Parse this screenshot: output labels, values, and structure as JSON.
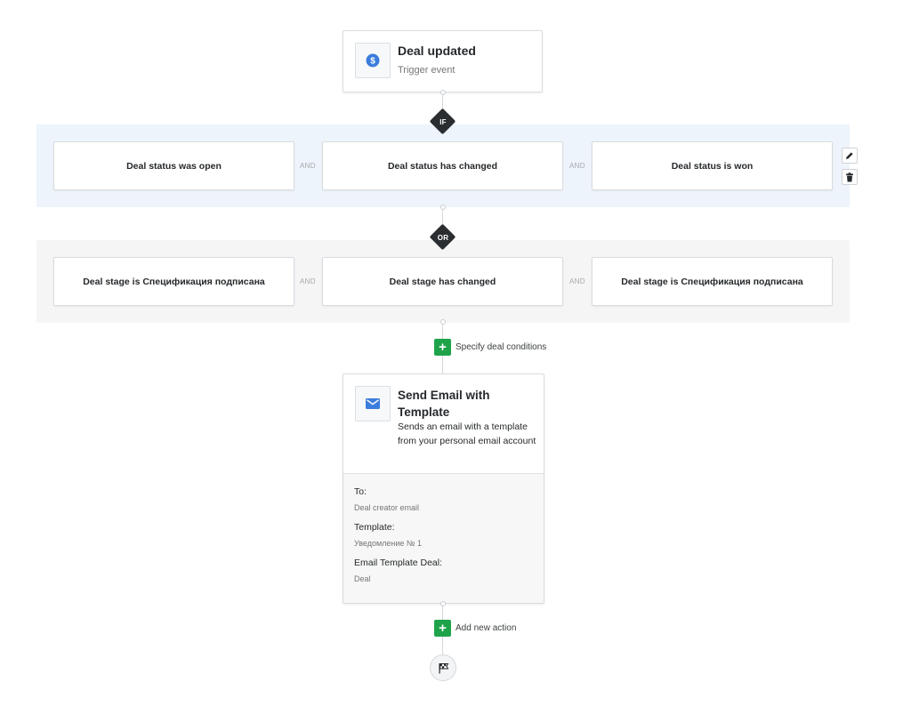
{
  "trigger": {
    "title": "Deal updated",
    "subtitle": "Trigger event",
    "icon": "dollar-icon",
    "icon_color": "#3b7ddd"
  },
  "if_group": {
    "badge": "IF",
    "conditions": [
      "Deal status was open",
      "Deal status has changed",
      "Deal status is won"
    ],
    "connector": "AND",
    "background": "#eef4fb"
  },
  "or_group": {
    "badge": "OR",
    "conditions": [
      "Deal stage is Спецификация подписана",
      "Deal stage has changed",
      "Deal stage is Спецификация подписана"
    ],
    "connector": "AND",
    "background": "#f5f5f6"
  },
  "specify_conditions": {
    "label": "Specify deal conditions",
    "icon": "plus-icon"
  },
  "action": {
    "title": "Send Email with Template",
    "description": "Sends an email with a template from your personal email account",
    "icon": "envelope-icon",
    "fields": [
      {
        "label": "To:",
        "value": "Deal creator email"
      },
      {
        "label": "Template:",
        "value": "Уведомление № 1"
      },
      {
        "label": "Email Template Deal:",
        "value": "Deal"
      }
    ]
  },
  "add_action": {
    "label": "Add new action",
    "icon": "plus-icon"
  },
  "end": {
    "icon": "finish-flag-icon"
  },
  "side_actions": {
    "edit_icon": "pencil-icon",
    "delete_icon": "trash-icon"
  },
  "colors": {
    "accent_green": "#1fa34a",
    "diamond": "#2b2e31",
    "brand_blue": "#3b7ddd"
  }
}
